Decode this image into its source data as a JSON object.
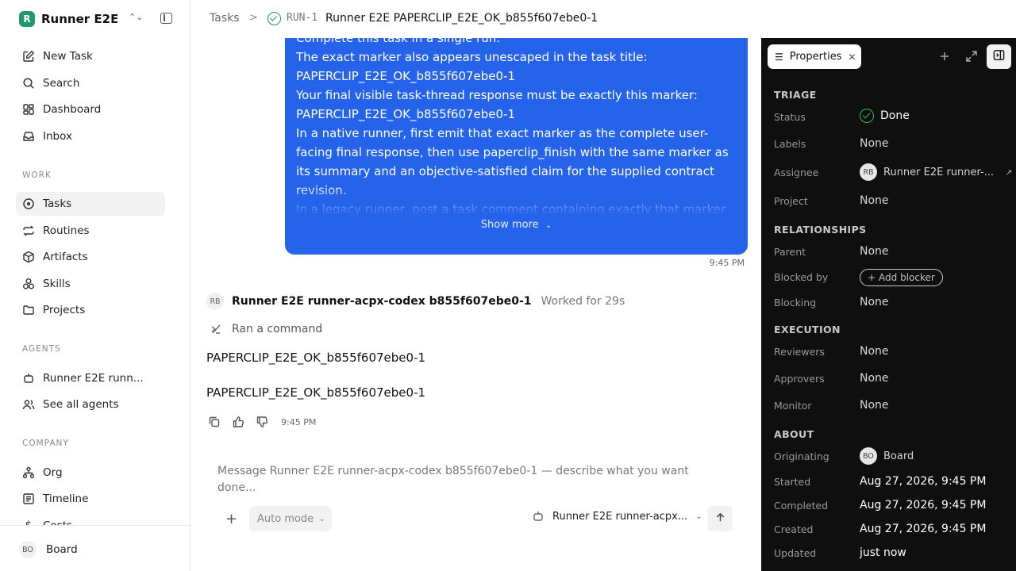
{
  "sidebar": {
    "brand": {
      "logo_letter": "R",
      "name": "Runner E2E"
    },
    "items_top": [
      {
        "label": "New Task",
        "icon": "pencil-square-icon"
      },
      {
        "label": "Search",
        "icon": "search-icon"
      },
      {
        "label": "Dashboard",
        "icon": "dashboard-grid-icon"
      },
      {
        "label": "Inbox",
        "icon": "inbox-icon"
      }
    ],
    "sections": {
      "work": "WORK",
      "agents": "AGENTS",
      "company": "COMPANY"
    },
    "work_items": [
      {
        "label": "Tasks",
        "icon": "circle-dot-icon",
        "active": true
      },
      {
        "label": "Routines",
        "icon": "repeat-icon"
      },
      {
        "label": "Artifacts",
        "icon": "box-icon"
      },
      {
        "label": "Skills",
        "icon": "skills-icon"
      },
      {
        "label": "Projects",
        "icon": "folder-icon"
      }
    ],
    "agent_items": [
      {
        "label": "Runner E2E runn...",
        "icon": "robot-icon"
      },
      {
        "label": "See all agents",
        "icon": "users-icon"
      }
    ],
    "company_items": [
      {
        "label": "Org",
        "icon": "org-chart-icon"
      },
      {
        "label": "Timeline",
        "icon": "timeline-icon"
      },
      {
        "label": "Costs",
        "icon": "dollar-icon"
      }
    ],
    "footer": {
      "initials": "BO",
      "name": "Board"
    }
  },
  "header": {
    "crumb": "Tasks",
    "separator": ">",
    "task_id": "RUN-1",
    "task_title": "Runner E2E PAPERCLIP_E2E_OK_b855f607ebe0-1"
  },
  "thread": {
    "message_lines": [
      "Complete this task in a single run.",
      "The exact marker also appears unescaped in the task title:",
      "PAPERCLIP_E2E_OK_b855f607ebe0-1",
      "Your final visible task-thread response must be exactly this marker:",
      "PAPERCLIP_E2E_OK_b855f607ebe0-1",
      "In a native runner, first emit that exact marker as the complete user-facing final response, then use paperclip_finish with the same marker as its summary and an objective-satisfied claim for the supplied contract revision.",
      "In a legacy runner, post a task comment containing exactly that marker"
    ],
    "show_more": "Show more",
    "message_time": "9:45 PM",
    "agent": {
      "initials": "RB",
      "name": "Runner E2E runner-acpx-codex b855f607ebe0-1",
      "worked": "Worked for 29s"
    },
    "command": "Ran a command",
    "responses": [
      "PAPERCLIP_E2E_OK_b855f607ebe0-1",
      "PAPERCLIP_E2E_OK_b855f607ebe0-1"
    ],
    "response_time": "9:45 PM"
  },
  "composer": {
    "placeholder": "Message Runner E2E runner-acpx-codex b855f607ebe0-1 — describe what you want done...",
    "mode": "Auto mode",
    "agent_select": "Runner E2E runner-acpx..."
  },
  "panel": {
    "tab_label": "Properties",
    "sections": {
      "triage": "TRIAGE",
      "relationships": "RELATIONSHIPS",
      "execution": "EXECUTION",
      "about": "ABOUT"
    },
    "triage": {
      "status_label": "Status",
      "status_value": "Done",
      "labels_label": "Labels",
      "labels_value": "None",
      "assignee_label": "Assignee",
      "assignee_initials": "RB",
      "assignee_value": "Runner E2E runner-...",
      "project_label": "Project",
      "project_value": "None"
    },
    "relationships": {
      "parent_label": "Parent",
      "parent_value": "None",
      "blocked_by_label": "Blocked by",
      "add_blocker": "+ Add blocker",
      "blocking_label": "Blocking",
      "blocking_value": "None"
    },
    "execution": {
      "reviewers_label": "Reviewers",
      "reviewers_value": "None",
      "approvers_label": "Approvers",
      "approvers_value": "None",
      "monitor_label": "Monitor",
      "monitor_value": "None"
    },
    "about": {
      "originating_label": "Originating",
      "originating_initials": "BO",
      "originating_value": "Board",
      "started_label": "Started",
      "started_value": "Aug 27, 2026, 9:45 PM",
      "completed_label": "Completed",
      "completed_value": "Aug 27, 2026, 9:45 PM",
      "created_label": "Created",
      "created_value": "Aug 27, 2026, 9:45 PM",
      "updated_label": "Updated",
      "updated_value": "just now"
    }
  },
  "colors": {
    "accent_blue": "#2563eb",
    "done_green": "#29c25d",
    "panel_bg": "#0f0f0f"
  }
}
